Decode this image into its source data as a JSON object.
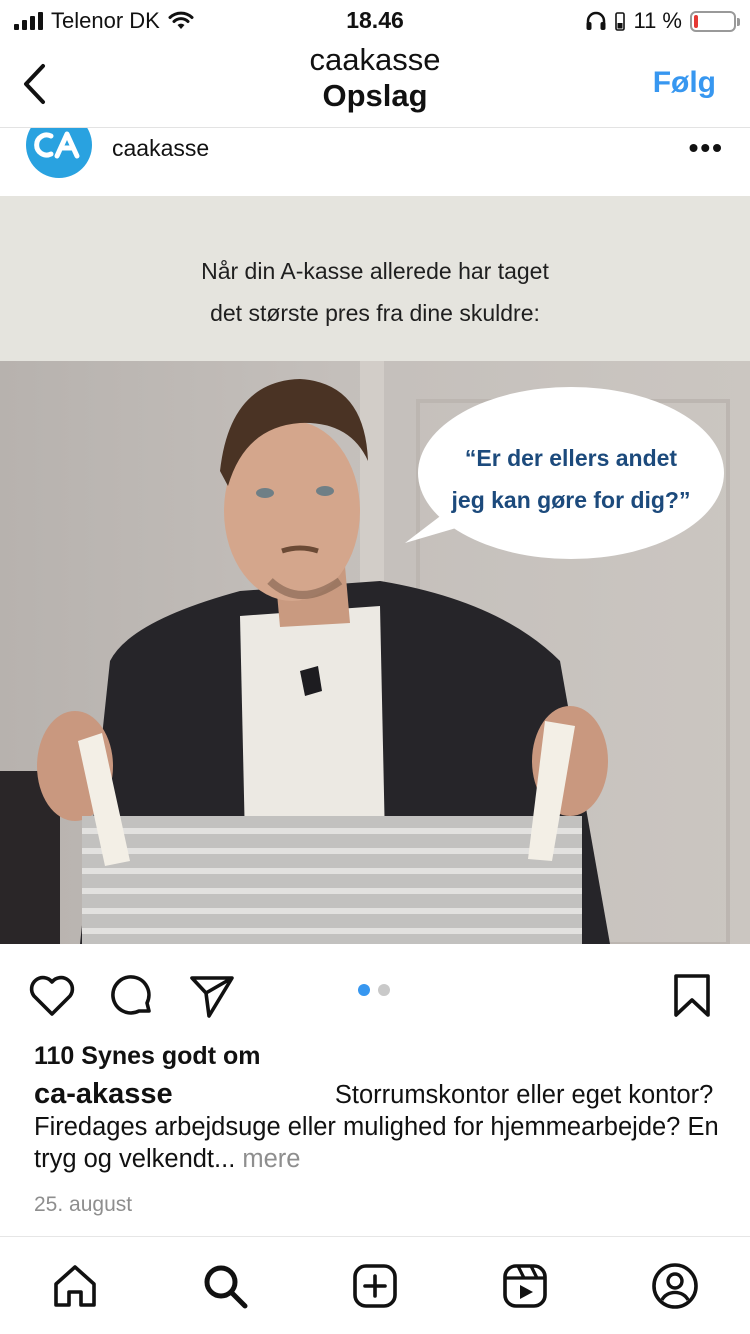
{
  "status_bar": {
    "carrier": "Telenor DK",
    "time": "18.46",
    "battery_percent": "11 %",
    "battery_level": 0.11,
    "low_battery_color": "#e53935"
  },
  "nav": {
    "account": "caakasse",
    "title": "Opslag",
    "follow_label": "Følg",
    "back_icon": "chevron-left-icon",
    "accent_color": "#3797f0"
  },
  "post": {
    "username": "caakasse",
    "avatar_icon": "ca-logo",
    "image": {
      "banner_line1": "Når din A-kasse allerede har taget",
      "banner_line2": "det største pres fra dine skuldre:",
      "bubble_line1": "“Er der ellers andet",
      "bubble_line2": "jeg kan gøre for dig?”"
    },
    "carousel": {
      "count": 2,
      "active_index": 0
    },
    "likes": "110 Synes godt om",
    "caption_user": "ca-akasse",
    "caption_text": "Storrumskontor eller eget kontor? Firedages arbejdsuge eller mulighed for hjemmearbejde? En tryg og velkendt...",
    "more_label": "mere",
    "date": "25. august"
  },
  "actions": [
    "heart-icon",
    "comment-icon",
    "share-icon",
    "bookmark-icon"
  ],
  "tab_bar": [
    "home-icon",
    "search-icon",
    "create-icon",
    "reels-icon",
    "profile-icon"
  ]
}
